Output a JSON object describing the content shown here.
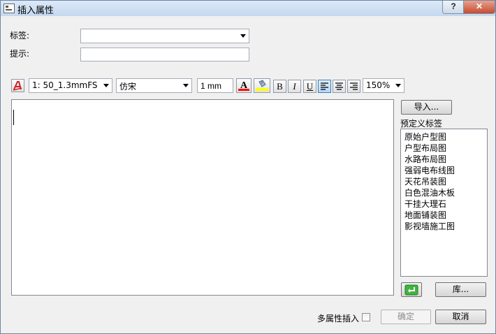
{
  "window": {
    "title": "插入属性",
    "help_label": "?",
    "close_label": "✕"
  },
  "form": {
    "tag_label": "标签:",
    "tag_value": "",
    "prompt_label": "提示:",
    "prompt_value": ""
  },
  "toolbar": {
    "text_style_icon": "text-style-icon",
    "style_value": "1: 50_1.3mmFS",
    "font_value": "仿宋",
    "height_value": "1 mm",
    "font_color_label": "A",
    "font_color": "#ff0000",
    "highlight_color": "#ffff00",
    "bold_label": "B",
    "italic_label": "I",
    "underline_label": "U",
    "zoom_value": "150%"
  },
  "editor": {
    "text": ""
  },
  "side": {
    "import_label": "导入...",
    "predefined_title": "预定义标签",
    "predefined_items": [
      "原始户型图",
      "户型布局图",
      "水路布局图",
      "强弱电布线图",
      "天花吊装图",
      "白色混油木板",
      "干挂大理石",
      "地面铺装图",
      "影视墙施工图"
    ],
    "insert_icon": "enter-arrow-icon",
    "library_label": "库..."
  },
  "footer": {
    "multi_insert_label": "多属性插入",
    "multi_insert_checked": false,
    "ok_label": "确定",
    "cancel_label": "取消"
  }
}
